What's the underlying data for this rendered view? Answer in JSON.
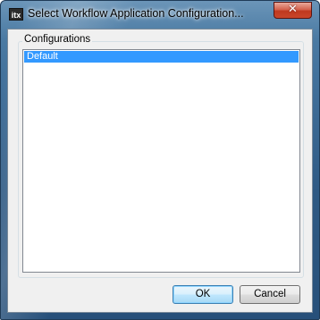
{
  "window": {
    "title": "Select Workflow Application Configuration...",
    "icon_text": "itx",
    "close_glyph": "✕"
  },
  "group": {
    "label": "Configurations"
  },
  "list": {
    "items": [
      {
        "label": "Default",
        "selected": true
      }
    ]
  },
  "buttons": {
    "ok_label": "OK",
    "cancel_label": "Cancel"
  },
  "colors": {
    "selection": "#3399ff",
    "close_button": "#c8452a",
    "frame": "#3e6d98"
  }
}
